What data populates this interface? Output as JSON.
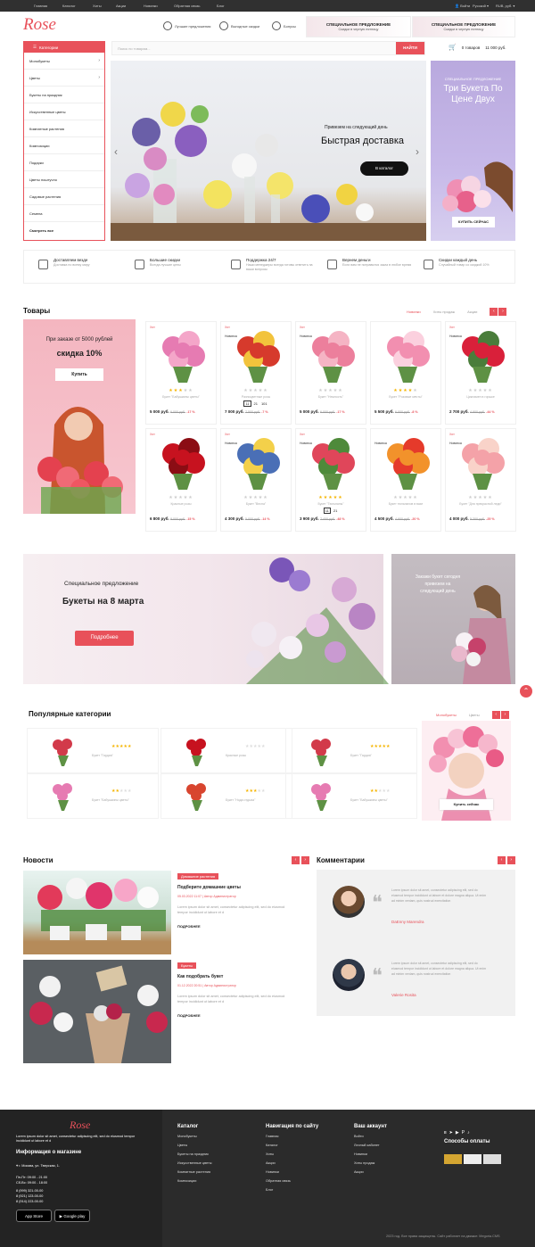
{
  "topbar": {
    "links": [
      "Главная",
      "Каталог",
      "Хиты",
      "Акции",
      "Новинки",
      "Обратная связь",
      "Блог"
    ],
    "login": "Войти",
    "lang": "Русский",
    "currency": "RUB, руб."
  },
  "header": {
    "logo": "Rose",
    "icons": [
      {
        "label": "Лучшие предложения",
        "icon": "gift-icon"
      },
      {
        "label": "Выгодные скидки",
        "icon": "percent-icon"
      },
      {
        "label": "Бонусы",
        "icon": "bonus-icon"
      }
    ],
    "promos": [
      {
        "title": "СПЕЦИАЛЬНОЕ ПРЕДЛОЖЕНИЕ",
        "sub": "Скидки в черную пятницу"
      },
      {
        "title": "СПЕЦИАЛЬНОЕ ПРЕДЛОЖЕНИЕ",
        "sub": "Скидки в черную пятницу"
      }
    ],
    "search_placeholder": "Поиск по товарам...",
    "search_button": "НАЙТИ",
    "cart_count": "0 товаров",
    "cart_total": "11 000 руб."
  },
  "categories": {
    "title": "Категории",
    "items": [
      "Монобукеты",
      "Цветы",
      "Букеты на праздник",
      "Искусственные цветы",
      "Комнатные растения",
      "Композиции",
      "Подарки",
      "Цветы поштучно",
      "Садовые растения",
      "Семена",
      "Смотреть все"
    ]
  },
  "hero": {
    "subtitle": "Привезем на следующий день",
    "title": "Быстрая доставка",
    "button": "В каталог"
  },
  "side_banner": {
    "small": "СПЕЦИАЛЬНОЕ ПРЕДЛОЖЕНИЕ",
    "title": "Три Букета По Цене Двух",
    "button": "КУПИТЬ СЕЙЧАС"
  },
  "features": [
    {
      "title": "Доставляем везде",
      "sub": "Доставка по всему миру"
    },
    {
      "title": "Большие скидки",
      "sub": "Всегда лучшие цены"
    },
    {
      "title": "Поддержка 24/7",
      "sub": "Наши менеджеры всегда готовы ответить на ваши вопросы"
    },
    {
      "title": "Вернем деньги",
      "sub": "Если вам не понравился заказ в любое время"
    },
    {
      "title": "Скидки каждый день",
      "sub": "Случайный товар со скидкой 10%"
    }
  ],
  "products_section": {
    "title": "Товары",
    "tabs": [
      "Новинки",
      "Хиты продаж",
      "Акции"
    ]
  },
  "pink_promo": {
    "line1": "При заказе от 5000 рублей",
    "line2": "скидка 10%",
    "button": "Купить"
  },
  "products": [
    {
      "badge": "Хит",
      "badge2": "",
      "name": "Букет \"Бабушкины цветы\"",
      "price": "5 000 руб.",
      "old": "6 000 руб.",
      "disc": "-17 %",
      "rating": 3,
      "colors": [
        "#e67bb2",
        "#f4a6c9"
      ]
    },
    {
      "badge": "Хит",
      "badge2": "Новинка",
      "name": "Разноцветные розы",
      "price": "7 000 руб.",
      "old": "7 500 руб.",
      "disc": "-7 %",
      "rating": 0,
      "qty": [
        "11",
        "21",
        "101"
      ],
      "colors": [
        "#d63a2c",
        "#f2c33c"
      ]
    },
    {
      "badge": "Хит",
      "badge2": "Новинка",
      "name": "Букет \"Нежность\"",
      "price": "5 000 руб.",
      "old": "6 000 руб.",
      "disc": "-17 %",
      "rating": 0,
      "colors": [
        "#ec7f9c",
        "#f5b4c4"
      ]
    },
    {
      "badge": "",
      "badge2": "",
      "name": "Букет \"Розовые мечты\"",
      "price": "5 500 руб.",
      "old": "6 000 руб.",
      "disc": "-8 %",
      "rating": 4,
      "colors": [
        "#f28fb0",
        "#fbd0de"
      ]
    },
    {
      "badge": "Хит",
      "badge2": "Новинка",
      "name": "Цикламен в горшке",
      "price": "2 700 руб.",
      "old": "4 800 руб.",
      "disc": "-44 %",
      "rating": 0,
      "colors": [
        "#d9203a",
        "#4a7d3b"
      ]
    },
    {
      "badge": "Хит",
      "badge2": "",
      "name": "Красные розы",
      "price": "6 800 руб.",
      "old": "8 000 руб.",
      "disc": "-15 %",
      "rating": 0,
      "colors": [
        "#c7121f",
        "#8b0d14"
      ]
    },
    {
      "badge": "Хит",
      "badge2": "Новинка",
      "name": "Букет \"Весна\"",
      "price": "4 300 руб.",
      "old": "5 000 руб.",
      "disc": "-14 %",
      "rating": 0,
      "colors": [
        "#4a6fb6",
        "#f3d04a"
      ]
    },
    {
      "badge": "Хит",
      "badge2": "Новинка",
      "name": "Букет \"Тюльпаны\"",
      "price": "3 900 руб.",
      "old": "7 400 руб.",
      "disc": "-48 %",
      "rating": 5,
      "qty": [
        "11",
        "21"
      ],
      "colors": [
        "#e0465a",
        "#4e8a3a"
      ]
    },
    {
      "badge": "",
      "badge2": "Новинка",
      "name": "Букет тюльпанов в вазе",
      "price": "4 500 руб.",
      "old": "4 900 руб.",
      "disc": "-20 %",
      "rating": 0,
      "colors": [
        "#f2922b",
        "#e53a2b"
      ]
    },
    {
      "badge": "Хит",
      "badge2": "Новинка",
      "name": "Букет \"Для прекрасной леди\"",
      "price": "4 000 руб.",
      "old": "5 300 руб.",
      "disc": "-25 %",
      "rating": 0,
      "colors": [
        "#f4a2a8",
        "#f9d3c9"
      ]
    }
  ],
  "big_promo": {
    "line1": "Специальное предложение",
    "line2": "Букеты на 8 марта",
    "button": "Подробнее"
  },
  "grey_promo": {
    "text": "Закажи букет сегодня привезем на следующий день"
  },
  "popular": {
    "title": "Популярные категории",
    "tabs": [
      "Монобукеты",
      "Цветы"
    ],
    "button": "Купить сейчас",
    "items": [
      {
        "name": "Букет \"Гардиа\"",
        "rating": 5,
        "color": "#d23a4a"
      },
      {
        "name": "Красные розы",
        "rating": 0,
        "color": "#c7121f"
      },
      {
        "name": "Букет \"Гардиа\"",
        "rating": 5,
        "color": "#d23a4a"
      },
      {
        "name": "Букет \"Бабушкины цветы\"",
        "rating": 2,
        "color": "#e67bb2"
      },
      {
        "name": "Букет \"Нода отдыха\"",
        "rating": 3,
        "color": "#d8452f"
      },
      {
        "name": "Букет \"Бабушкины цветы\"",
        "rating": 2,
        "color": "#e67bb2"
      }
    ]
  },
  "news": {
    "title": "Новости",
    "items": [
      {
        "tag": "Домашние растения",
        "title": "Подберите домашние цветы",
        "meta": "05.03.2022 11:07  |  Автор Администратор",
        "text": "Lorem ipsum dolor sit amet, consectetur adipiscing elit, sed do eiusmod tempor incididunt ut labore et d",
        "more": "ПОДРОБНЕЕ"
      },
      {
        "tag": "Букеты",
        "title": "Как подобрать букет",
        "meta": "01.12.2022 20:51  |  Автор Администратор",
        "text": "Lorem ipsum dolor sit amet, consectetur adipiscing elit, sed do eiusmod tempor incididunt ut labore et d",
        "more": "ПОДРОБНЕЕ"
      }
    ]
  },
  "comments": {
    "title": "Комментарии",
    "items": [
      {
        "text": "Lorem ipsum dolor sit amet, consectetur adipiscing elit, sed do eiusmod tempor incididunt ut labore et dolore magna aliqua. Ut enim ad minim veniam, quis nostrud exercitation",
        "name": "DaEnny Marendra"
      },
      {
        "text": "Lorem ipsum dolor sit amet, consectetur adipiscing elit, sed do eiusmod tempor incididunt ut labore et dolore magna aliqua. Ut enim ad minim veniam, quis nostrud exercitation",
        "name": "Valerie Rosita"
      }
    ]
  },
  "footer": {
    "logo": "Rose",
    "about": "Lorem ipsum dolor sit amet, consectetur adipiscing elit, sed do eiusmod tempor incididunt ut labore et d",
    "info_title": "Информация о магазине",
    "address": "г. Москва, ул. Тверская, 1.",
    "hours1": "Пн-Пт: 09:00 - 21:00",
    "hours2": "Сб-Вс: 09:00 - 18:00",
    "phones": [
      "8 (999) 321-00-00",
      "8 (921) 123-00-00",
      "8 (914) 223-00-00"
    ],
    "app_store": "App Store",
    "google_play": "Google play",
    "col1": {
      "title": "Каталог",
      "links": [
        "Монобукеты",
        "Цветы",
        "Букеты на праздник",
        "Искусственные цветы",
        "Комнатные растения",
        "Композиции"
      ]
    },
    "col2": {
      "title": "Навигация по сайту",
      "links": [
        "Главная",
        "Каталог",
        "Хиты",
        "Акции",
        "Новинки",
        "Обратная связь",
        "Блог"
      ]
    },
    "col3": {
      "title": "Ваш аккаунт",
      "links": [
        "Войти",
        "Личный кабинет",
        "Новинки",
        "Хиты продаж",
        "Акции"
      ]
    },
    "pay_title": "Способы оплаты",
    "copyright": "2023 год. Все права защищены. Сайт работает на движке: Megoria.CMS"
  }
}
